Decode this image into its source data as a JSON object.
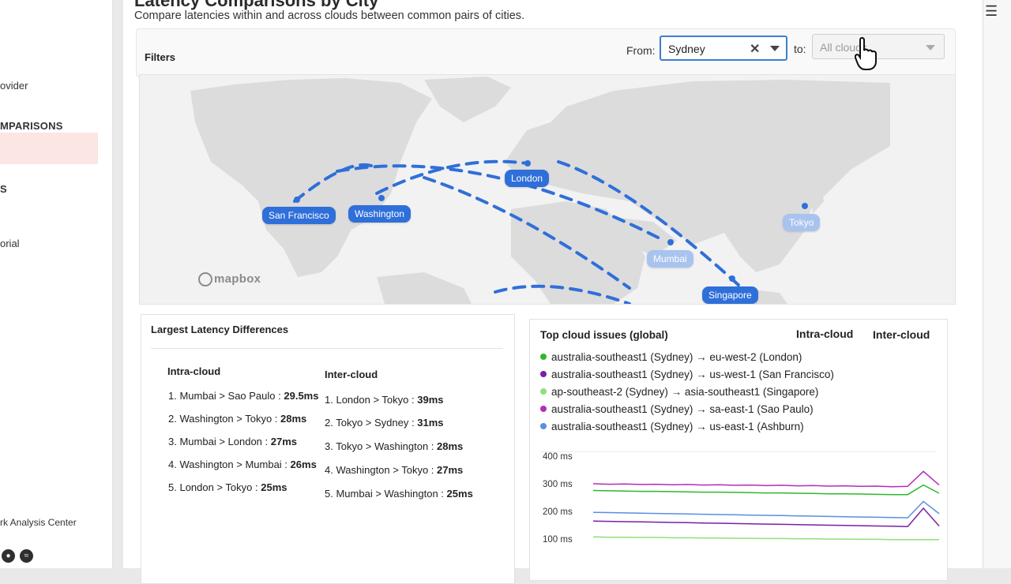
{
  "sidebar": {
    "partial_item_1": "ovider",
    "section_heading": "MPARISONS",
    "partial_item_2": "S",
    "partial_item_3": "orial",
    "footer_link": "rk Analysis Center",
    "footer_icons": [
      "github-icon",
      "rss-icon"
    ]
  },
  "header": {
    "title": "Latency Comparisons by City",
    "subtitle": "Compare latencies within and across clouds between common pairs of cities."
  },
  "filters": {
    "label": "Filters",
    "from_label": "From:",
    "from_value": "Sydney",
    "to_label": "to:",
    "to_placeholder": "All clouds"
  },
  "map": {
    "attribution": "mapbox",
    "cities": [
      {
        "name": "San Francisco",
        "active": true
      },
      {
        "name": "Washington",
        "active": true
      },
      {
        "name": "London",
        "active": true
      },
      {
        "name": "Mumbai",
        "active": false
      },
      {
        "name": "Tokyo",
        "active": false
      },
      {
        "name": "Singapore",
        "active": true
      }
    ],
    "accent": "#2f6fd9"
  },
  "differences": {
    "title": "Largest Latency Differences",
    "intra_heading": "Intra-cloud",
    "inter_heading": "Inter-cloud",
    "intra": [
      {
        "rank": "1.",
        "pair": "Mumbai > Sao Paulo :",
        "value": "29.5ms"
      },
      {
        "rank": "2.",
        "pair": "Washington > Tokyo :",
        "value": "28ms"
      },
      {
        "rank": "3.",
        "pair": "Mumbai > London :",
        "value": "27ms"
      },
      {
        "rank": "4.",
        "pair": "Washington > Mumbai :",
        "value": "26ms"
      },
      {
        "rank": "5.",
        "pair": "London > Tokyo :",
        "value": "25ms"
      }
    ],
    "inter": [
      {
        "rank": "1.",
        "pair": "London > Tokyo :",
        "value": "39ms"
      },
      {
        "rank": "2.",
        "pair": "Tokyo > Sydney :",
        "value": "31ms"
      },
      {
        "rank": "3.",
        "pair": "Tokyo > Washington :",
        "value": "28ms"
      },
      {
        "rank": "4.",
        "pair": "Washington > Tokyo :",
        "value": "27ms"
      },
      {
        "rank": "5.",
        "pair": "Mumbai > Washington :",
        "value": "25ms"
      }
    ]
  },
  "issues": {
    "title": "Top cloud issues (global)",
    "intra_heading": "Intra-cloud",
    "inter_heading": "Inter-cloud",
    "rows": [
      {
        "text": "australia-southeast1 (Sydney) → eu-west-2 (London)",
        "color": "#2eb82e"
      },
      {
        "text": "australia-southeast1 (Sydney) → us-west-1 (San Francisco)",
        "color": "#7a1fa8"
      },
      {
        "text": "ap-southeast-2 (Sydney) → asia-southeast1 (Singapore)",
        "color": "#8ee07a"
      },
      {
        "text": "australia-southeast1 (Sydney) → sa-east-1 (Sao Paulo)",
        "color": "#b02fb8"
      },
      {
        "text": "australia-southeast1 (Sydney) → us-east-1 (Ashburn)",
        "color": "#5b8ee0"
      }
    ]
  },
  "chart_data": {
    "type": "line",
    "ylabel": "",
    "y_ticks": [
      "400 ms",
      "300 ms",
      "200 ms",
      "100 ms"
    ],
    "ylim": [
      75,
      400
    ],
    "series": [
      {
        "name": "australia-southeast1 (Sydney) → us-west-1 (San Francisco)",
        "color": "#b02fb8",
        "values": [
          305,
          303,
          304,
          302,
          303,
          301,
          302,
          300,
          301,
          299,
          300,
          298,
          299,
          297,
          298,
          296,
          297,
          295,
          296,
          294,
          295,
          350,
          300
        ]
      },
      {
        "name": "australia-southeast1 (Sydney) → eu-west-2 (London)",
        "color": "#2eb82e",
        "values": [
          280,
          279,
          278,
          277,
          277,
          276,
          275,
          274,
          274,
          273,
          272,
          271,
          271,
          270,
          269,
          268,
          268,
          267,
          266,
          265,
          265,
          300,
          270
        ]
      },
      {
        "name": "australia-southeast1 (Sydney) → us-east-1 (Ashburn)",
        "color": "#5b8ee0",
        "values": [
          200,
          199,
          198,
          197,
          196,
          195,
          194,
          193,
          192,
          191,
          190,
          189,
          188,
          187,
          186,
          185,
          184,
          183,
          182,
          181,
          180,
          240,
          195
        ]
      },
      {
        "name": "australia-southeast1 (Sydney) → sa-east-1 (Sao Paulo)",
        "color": "#7a1fa8",
        "values": [
          168,
          167,
          166,
          165,
          164,
          163,
          162,
          161,
          160,
          159,
          158,
          157,
          156,
          155,
          154,
          153,
          152,
          151,
          150,
          149,
          148,
          215,
          150
        ]
      },
      {
        "name": "ap-southeast-2 (Sydney) → asia-southeast1 (Singapore)",
        "color": "#8ee07a",
        "values": [
          110,
          109,
          109,
          108,
          108,
          107,
          107,
          106,
          106,
          105,
          105,
          104,
          104,
          103,
          103,
          102,
          102,
          101,
          101,
          100,
          100,
          100,
          100
        ]
      }
    ]
  }
}
